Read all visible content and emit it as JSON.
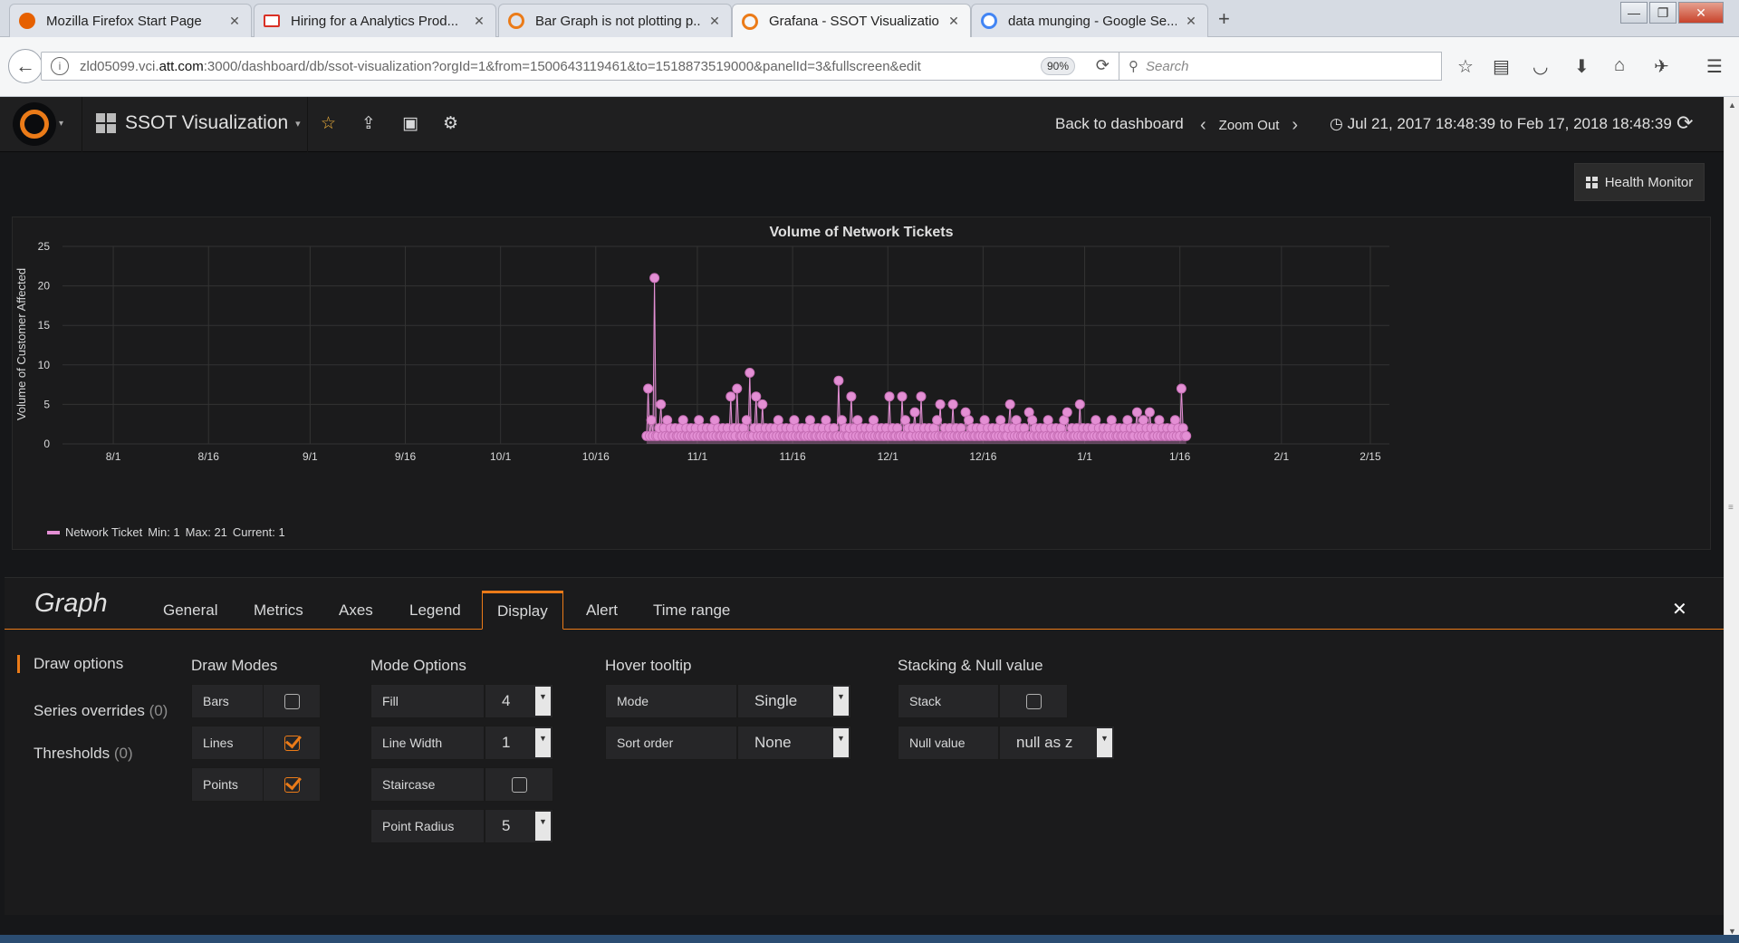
{
  "browser": {
    "tabs": [
      {
        "title": "Mozilla Firefox Start Page",
        "color": "#e66000"
      },
      {
        "title": "Hiring for a Analytics Prod...",
        "color": "#d93025"
      },
      {
        "title": "Bar Graph is not plotting p...",
        "color": "#eb7b18"
      },
      {
        "title": "Grafana - SSOT Visualization",
        "color": "#eb7b18"
      },
      {
        "title": "data munging - Google Se...",
        "color": "#4285f4"
      }
    ],
    "url_prefix": "zld05099.vci.",
    "url_domain": "att.com",
    "url_rest": ":3000/dashboard/db/ssot-visualization?orgId=1&from=1500643119461&to=1518873519000&panelId=3&fullscreen&edit",
    "zoom": "90%",
    "search_placeholder": "Search"
  },
  "grafana": {
    "dashboard_title": "SSOT Visualization",
    "back_to_dashboard": "Back to dashboard",
    "zoom_out": "Zoom Out",
    "time_range": "Jul 21, 2017 18:48:39 to Feb 17, 2018 18:48:39",
    "health_monitor": "Health Monitor"
  },
  "chart_data": {
    "type": "line",
    "title": "Volume of Network Tickets",
    "ylabel": "Volume of Customer Affected",
    "xlabel": "",
    "ylim": [
      0,
      25
    ],
    "yticks": [
      "0",
      "5",
      "10",
      "15",
      "20",
      "25"
    ],
    "xticks": [
      "8/1",
      "8/16",
      "9/1",
      "9/16",
      "10/1",
      "10/16",
      "11/1",
      "11/16",
      "12/1",
      "12/16",
      "1/1",
      "1/16",
      "2/1",
      "2/15"
    ],
    "series": [
      {
        "name": "Network Ticket",
        "color": "#e38fd4",
        "x_start": "2017-10-24",
        "x_end": "2018-01-17",
        "min": 1,
        "max": 21,
        "current": 1,
        "peaks": [
          {
            "date": "2017-10-24",
            "value": 7
          },
          {
            "date": "2017-10-25",
            "value": 21
          },
          {
            "date": "2017-10-26",
            "value": 5
          },
          {
            "date": "2017-11-06",
            "value": 6
          },
          {
            "date": "2017-11-07",
            "value": 7
          },
          {
            "date": "2017-11-09",
            "value": 9
          },
          {
            "date": "2017-11-10",
            "value": 6
          },
          {
            "date": "2017-11-11",
            "value": 5
          },
          {
            "date": "2017-11-23",
            "value": 8
          },
          {
            "date": "2017-11-25",
            "value": 6
          },
          {
            "date": "2017-12-01",
            "value": 6
          },
          {
            "date": "2017-12-03",
            "value": 6
          },
          {
            "date": "2017-12-05",
            "value": 4
          },
          {
            "date": "2017-12-06",
            "value": 6
          },
          {
            "date": "2017-12-09",
            "value": 5
          },
          {
            "date": "2017-12-11",
            "value": 5
          },
          {
            "date": "2017-12-13",
            "value": 4
          },
          {
            "date": "2017-12-20",
            "value": 5
          },
          {
            "date": "2017-12-23",
            "value": 4
          },
          {
            "date": "2017-12-29",
            "value": 4
          },
          {
            "date": "2017-12-31",
            "value": 5
          },
          {
            "date": "2018-01-09",
            "value": 4
          },
          {
            "date": "2018-01-11",
            "value": 4
          },
          {
            "date": "2018-01-16",
            "value": 7
          }
        ]
      }
    ],
    "legend": {
      "label": "Network Ticket",
      "min_text": "Min: 1",
      "max_text": "Max: 21",
      "current_text": "Current: 1"
    }
  },
  "editor": {
    "title": "Graph",
    "tabs": [
      "General",
      "Metrics",
      "Axes",
      "Legend",
      "Display",
      "Alert",
      "Time range"
    ],
    "active_tab": "Display",
    "side": {
      "draw_options": "Draw options",
      "series_overrides": "Series overrides",
      "series_overrides_count": "(0)",
      "thresholds": "Thresholds",
      "thresholds_count": "(0)"
    },
    "draw_modes": {
      "heading": "Draw Modes",
      "bars": "Bars",
      "lines": "Lines",
      "points": "Points"
    },
    "mode_options": {
      "heading": "Mode Options",
      "fill": "Fill",
      "fill_value": "4",
      "line_width": "Line Width",
      "line_width_value": "1",
      "staircase": "Staircase",
      "point_radius": "Point Radius",
      "point_radius_value": "5"
    },
    "hover_tooltip": {
      "heading": "Hover tooltip",
      "mode": "Mode",
      "mode_value": "Single",
      "sort_order": "Sort order",
      "sort_value": "None"
    },
    "stacking": {
      "heading": "Stacking & Null value",
      "stack": "Stack",
      "null_value": "Null value",
      "null_value_value": "null as z"
    }
  }
}
